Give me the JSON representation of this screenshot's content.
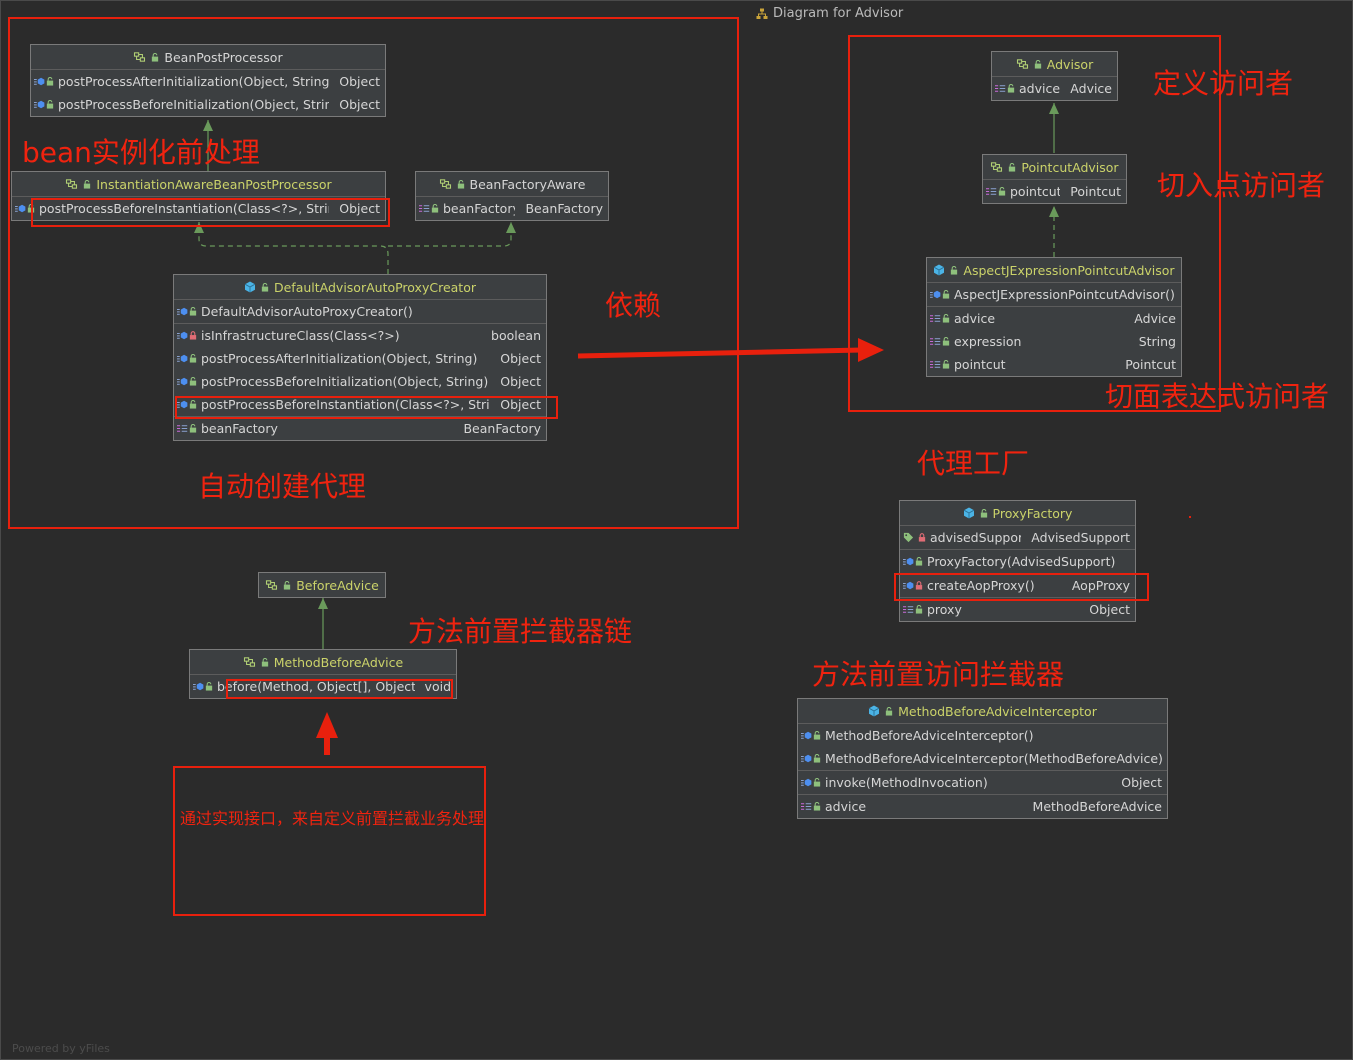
{
  "window": {
    "title": "Diagram for Advisor",
    "footer": "Powered by yFiles"
  },
  "colors": {
    "annotation": "#e8200d",
    "edge": "#6a9a5b",
    "node_bg": "#3c3f41",
    "class_name": "#cbd36a"
  },
  "annotations": {
    "bean_preinst": "bean实例化前处理",
    "auto_proxy": "自动创建代理",
    "dependency": "依赖",
    "define_visitor": "定义访问者",
    "pointcut_visitor": "切入点访问者",
    "aspect_visitor": "切面表达式访问者",
    "proxy_factory": "代理工厂",
    "method_before_chain": "方法前置拦截器链",
    "method_before_interceptor": "方法前置访问拦截器",
    "custom_note": "通过实现接口，来自定义前置拦截业务处理"
  },
  "nodes": {
    "bean_post_processor": {
      "name": "BeanPostProcessor",
      "rows": [
        {
          "label": "postProcessAfterInitialization(Object, String)",
          "type": "Object"
        },
        {
          "label": "postProcessBeforeInitialization(Object, String)",
          "type": "Object"
        }
      ]
    },
    "instantiation_aware": {
      "name": "InstantiationAwareBeanPostProcessor",
      "rows": [
        {
          "label": "postProcessBeforeInstantiation(Class<?>, String)",
          "type": "Object"
        }
      ]
    },
    "bean_factory_aware": {
      "name": "BeanFactoryAware",
      "rows": [
        {
          "label": "beanFactory",
          "type": "BeanFactory"
        }
      ]
    },
    "default_advisor": {
      "name": "DefaultAdvisorAutoProxyCreator",
      "constructor": "DefaultAdvisorAutoProxyCreator()",
      "methods": [
        {
          "label": "isInfrastructureClass(Class<?>)",
          "type": "boolean"
        },
        {
          "label": "postProcessAfterInitialization(Object, String)",
          "type": "Object"
        },
        {
          "label": "postProcessBeforeInitialization(Object, String)",
          "type": "Object"
        },
        {
          "label": "postProcessBeforeInstantiation(Class<?>, String)",
          "type": "Object"
        }
      ],
      "fields": [
        {
          "label": "beanFactory",
          "type": "BeanFactory"
        }
      ]
    },
    "advisor": {
      "name": "Advisor",
      "rows": [
        {
          "label": "advice",
          "type": "Advice"
        }
      ]
    },
    "pointcut_advisor": {
      "name": "PointcutAdvisor",
      "rows": [
        {
          "label": "pointcut",
          "type": "Pointcut"
        }
      ]
    },
    "aspectj_advisor": {
      "name": "AspectJExpressionPointcutAdvisor",
      "constructor": "AspectJExpressionPointcutAdvisor()",
      "fields": [
        {
          "label": "advice",
          "type": "Advice"
        },
        {
          "label": "expression",
          "type": "String"
        },
        {
          "label": "pointcut",
          "type": "Pointcut"
        }
      ]
    },
    "proxy_factory": {
      "name": "ProxyFactory",
      "field_top": {
        "label": "advisedSupport",
        "type": "AdvisedSupport"
      },
      "constructor": "ProxyFactory(AdvisedSupport)",
      "method": {
        "label": "createAopProxy()",
        "type": "AopProxy"
      },
      "field": {
        "label": "proxy",
        "type": "Object"
      }
    },
    "before_advice": {
      "name": "BeforeAdvice"
    },
    "method_before_advice": {
      "name": "MethodBeforeAdvice",
      "rows": [
        {
          "label": "before(Method, Object[], Object)",
          "type": "void"
        }
      ]
    },
    "method_before_interceptor": {
      "name": "MethodBeforeAdviceInterceptor",
      "constructors": [
        "MethodBeforeAdviceInterceptor()",
        "MethodBeforeAdviceInterceptor(MethodBeforeAdvice)"
      ],
      "method": {
        "label": "invoke(MethodInvocation)",
        "type": "Object"
      },
      "field": {
        "label": "advice",
        "type": "MethodBeforeAdvice"
      }
    }
  }
}
